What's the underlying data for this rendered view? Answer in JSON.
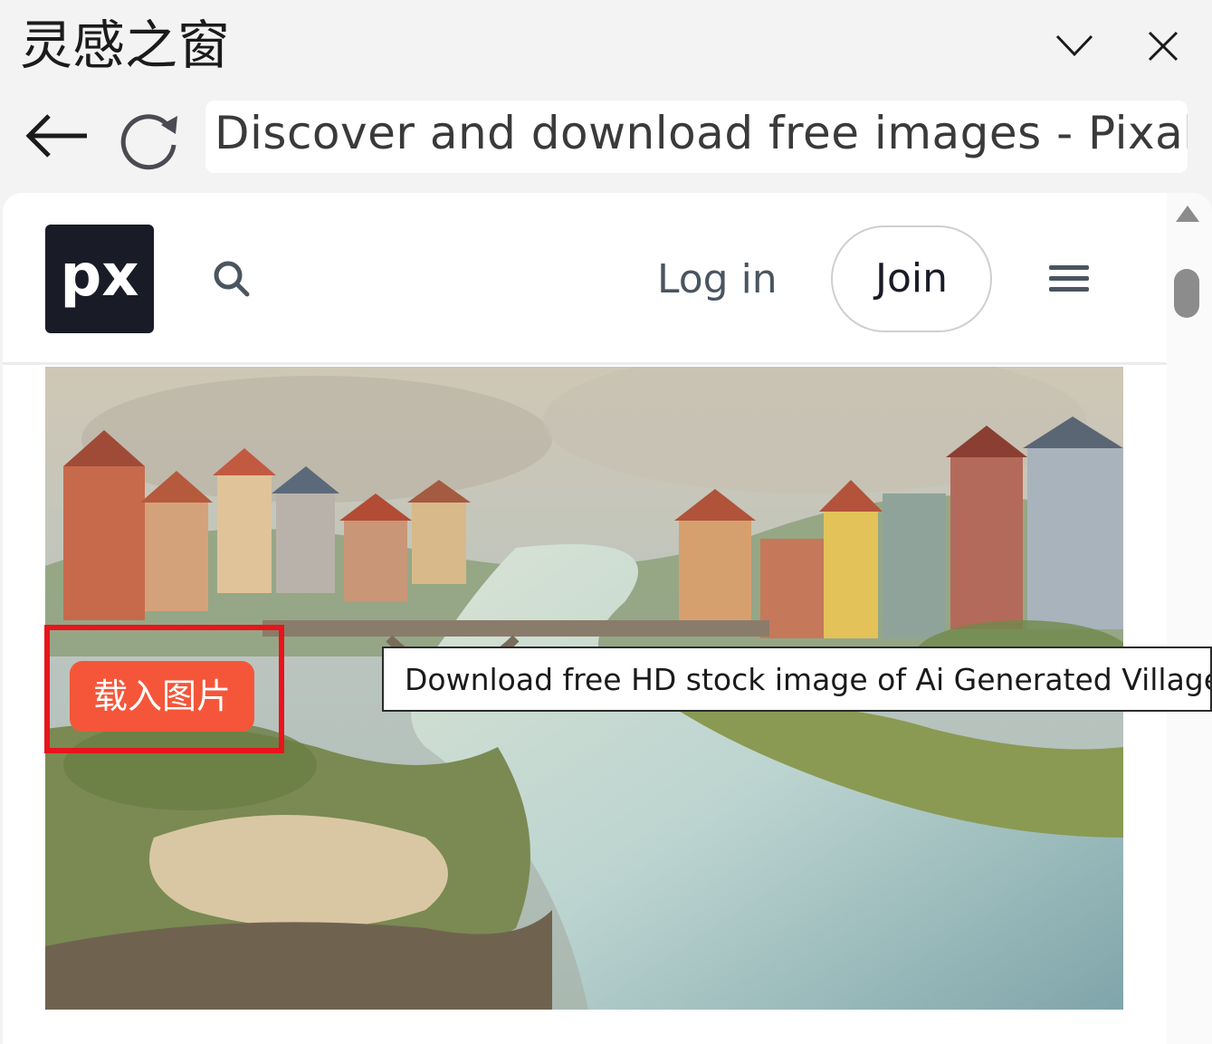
{
  "window": {
    "title": "灵感之窗",
    "minimize_icon": "chevron-down-icon",
    "close_icon": "close-icon"
  },
  "browser": {
    "back_icon": "arrow-left-icon",
    "reload_icon": "reload-icon",
    "address_text": "Discover and download free images - Pixabay"
  },
  "site": {
    "logo_text": "px",
    "search_icon": "search-icon",
    "login_label": "Log in",
    "join_label": "Join",
    "menu_icon": "hamburger-menu-icon",
    "brand_color": "#191b26"
  },
  "image": {
    "subject": "Ai Generated Village",
    "tooltip": "Download free HD stock image of Ai Generated Village"
  },
  "overlay": {
    "load_button_label": "载入图片",
    "load_button_color": "#f5563a",
    "highlight_color": "#e8141c"
  }
}
